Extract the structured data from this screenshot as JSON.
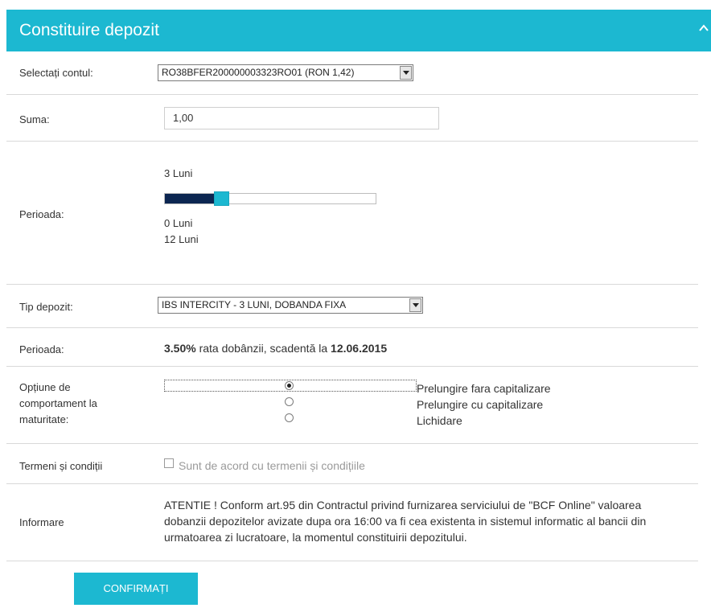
{
  "header": {
    "title": "Constituire depozit"
  },
  "account": {
    "label": "Selectați contul:",
    "selected": "RO38BFER200000003323RO01 (RON 1,42)"
  },
  "amount": {
    "label": "Suma:",
    "value": "1,00"
  },
  "period": {
    "label": "Perioada:",
    "current": "3 Luni",
    "min": "0 Luni",
    "max": "12 Luni",
    "slider_fraction": 0.25
  },
  "deposit_type": {
    "label": "Tip depozit:",
    "selected": "IBS INTERCITY - 3 LUNI, DOBANDA FIXA"
  },
  "rate": {
    "label": "Perioada:",
    "rate_value": "3.50%",
    "rate_text": " rata dobânzii, scadentă la ",
    "maturity_date": "12.06.2015"
  },
  "maturity_option": {
    "label": "Opțiune de comportament la maturitate:",
    "options": [
      {
        "label": "Prelungire fara capitalizare",
        "checked": true
      },
      {
        "label": "Prelungire cu capitalizare",
        "checked": false
      },
      {
        "label": "Lichidare",
        "checked": false
      }
    ]
  },
  "terms": {
    "label": "Termeni și condiții",
    "checkbox_label": "Sunt de acord cu termenii și condițiile"
  },
  "info": {
    "label": "Informare",
    "text": "ATENTIE ! Conform art.95 din Contractul privind furnizarea serviciului de \"BCF Online\" valoarea dobanzii depozitelor avizate dupa ora 16:00 va fi cea existenta in sistemul informatic al bancii din urmatoarea zi lucratoare, la momentul constituirii depozitului."
  },
  "actions": {
    "confirm_label": "CONFIRMAȚI"
  },
  "colors": {
    "accent": "#1cb8d1",
    "slider_fill": "#0c2651"
  }
}
